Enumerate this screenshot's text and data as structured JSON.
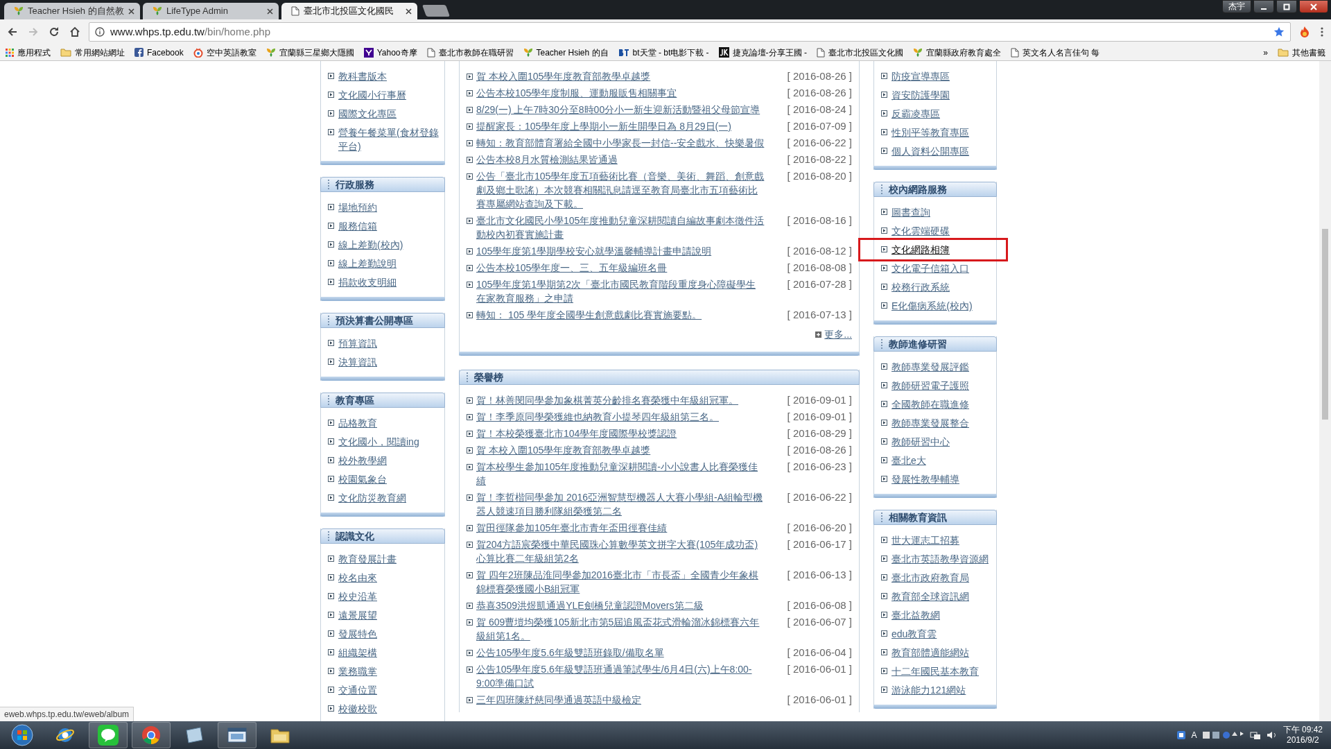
{
  "browser": {
    "tabs": [
      {
        "title": "Teacher Hsieh 的自然教",
        "kind": "leaf",
        "selected": false
      },
      {
        "title": "LifeType Admin",
        "kind": "leaf",
        "selected": false
      },
      {
        "title": "臺北市北投區文化國民",
        "kind": "page",
        "selected": true
      }
    ],
    "profile": "杰宇",
    "address": {
      "host": "www.whps.tp.edu.tw",
      "path": "/bin/home.php"
    },
    "bookmarks": [
      {
        "label": "應用程式",
        "kind": "apps"
      },
      {
        "label": "常用網站網址",
        "kind": "folder"
      },
      {
        "label": "Facebook",
        "kind": "facebook"
      },
      {
        "label": "空中英語教室",
        "kind": "radio"
      },
      {
        "label": "宜蘭縣三星鄉大隱國",
        "kind": "leaf"
      },
      {
        "label": "Yahoo奇摩",
        "kind": "yahoo"
      },
      {
        "label": "臺北市教師在職研習",
        "kind": "page"
      },
      {
        "label": "Teacher Hsieh 的自",
        "kind": "leaf"
      },
      {
        "label": "bt天堂 - bt电影下載 -",
        "kind": "bt"
      },
      {
        "label": "捷克論壇-分享王國 -",
        "kind": "jk"
      },
      {
        "label": "臺北市北投區文化國",
        "kind": "page"
      },
      {
        "label": "宜蘭縣政府教育處全",
        "kind": "leaf"
      },
      {
        "label": "英文名人名言佳句 每",
        "kind": "page"
      }
    ],
    "overflow": "»",
    "other_bookmarks": "其他書籤"
  },
  "left_panels": [
    {
      "items": [
        {
          "text": "教科書版本"
        },
        {
          "text": "文化國小行事曆"
        },
        {
          "text": "國際文化專區"
        },
        {
          "text": "營養午餐菜單(食材登錄平台)"
        }
      ]
    },
    {
      "title": "行政服務",
      "items": [
        {
          "text": "場地預約"
        },
        {
          "text": "服務信箱"
        },
        {
          "text": "線上差勤(校內)"
        },
        {
          "text": "線上差勤說明"
        },
        {
          "text": "捐款收支明細"
        }
      ]
    },
    {
      "title": "預決算書公開專區",
      "items": [
        {
          "text": "預算資訊"
        },
        {
          "text": "決算資訊"
        }
      ]
    },
    {
      "title": "教育專區",
      "items": [
        {
          "text": "品格教育"
        },
        {
          "text": "文化國小，閱讀ing"
        },
        {
          "text": "校外教學網"
        },
        {
          "text": "校園氣象台"
        },
        {
          "text": "文化防災教育網"
        }
      ]
    },
    {
      "title": "認識文化",
      "items": [
        {
          "text": "教育發展計畫"
        },
        {
          "text": "校名由來"
        },
        {
          "text": "校史沿革"
        },
        {
          "text": "遠景展望"
        },
        {
          "text": "發展特色"
        },
        {
          "text": "組織架構"
        },
        {
          "text": "業務職掌"
        },
        {
          "text": "交通位置"
        },
        {
          "text": "校徽校歌"
        }
      ]
    }
  ],
  "news": {
    "items": [
      {
        "text": "賀 本校入圍105學年度教育部教學卓越獎",
        "date": "[ 2016-08-26 ]"
      },
      {
        "text": "公告本校105學年度制服、運動服販售相關事宜",
        "date": "[ 2016-08-26 ]"
      },
      {
        "text": "8/29(一) 上午7時30分至8時00分小一新生迎新活動暨祖父母節宣導",
        "date": "[ 2016-08-24 ]"
      },
      {
        "text": "提醒家長：105學年度上學期小一新生開學日為 8月29日(一)",
        "date": "[ 2016-07-09 ]"
      },
      {
        "text": "轉知：教育部體育署給全國中小學家長一封信--安全戲水、快樂暑假",
        "date": "[ 2016-06-22 ]"
      },
      {
        "text": "公告本校8月水質檢測結果皆通過",
        "date": "[ 2016-08-22 ]"
      },
      {
        "text": "公告「臺北市105學年度五項藝術比賽（音樂、美術、舞蹈、創意戲劇及鄉土歌謠）本次競賽相關訊息請逕至教育局臺北市五項藝術比賽專屬網站查詢及下載。",
        "date": "[ 2016-08-20 ]"
      },
      {
        "text": "臺北市文化國民小學105年度推動兒童深耕閱讀自編故事劇本徵件活動校內初賽實施計畫",
        "date": "[ 2016-08-16 ]"
      },
      {
        "text": "105學年度第1學期學校安心就學溫馨輔導計畫申請說明",
        "date": "[ 2016-08-12 ]"
      },
      {
        "text": "公告本校105學年度一、三、五年級編班名冊",
        "date": "[ 2016-08-08 ]"
      },
      {
        "text": "105學年度第1學期第2次「臺北市國民教育階段重度身心障礙學生在家教育服務」之申請",
        "date": "[ 2016-07-28 ]"
      },
      {
        "text": "轉知： 105 學年度全國學生創意戲劇比賽實施要點。",
        "date": "[ 2016-07-13 ]"
      }
    ],
    "more": "更多..."
  },
  "honor": {
    "title": "榮譽榜",
    "items": [
      {
        "text": "賀！林善閔同學參加象棋菁英分齡排名賽榮獲中年級組冠軍。",
        "date": "[ 2016-09-01 ]"
      },
      {
        "text": "賀！李季原同學榮獲維也納教育小提琴四年級組第三名。",
        "date": "[ 2016-09-01 ]"
      },
      {
        "text": "賀！本校榮獲臺北市104學年度國際學校獎認證",
        "date": "[ 2016-08-29 ]"
      },
      {
        "text": "賀 本校入圍105學年度教育部教學卓越獎",
        "date": "[ 2016-08-26 ]"
      },
      {
        "text": "賀本校學生參加105年度推動兒童深耕閱讀-小小說書人比賽榮獲佳績",
        "date": "[ 2016-06-23 ]"
      },
      {
        "text": "賀！李哲楷同學參加 2016亞洲智慧型機器人大賽小學組-A組輪型機器人競速項目勝利隊組榮獲第二名",
        "date": "[ 2016-06-22 ]"
      },
      {
        "text": "賀田徑隊參加105年臺北市青年盃田徑賽佳績",
        "date": "[ 2016-06-20 ]"
      },
      {
        "text": "賀204方語宸榮獲中華民國珠心算數學英文拼字大賽(105年成功盃)心算比賽二年級組第2名",
        "date": "[ 2016-06-17 ]"
      },
      {
        "text": "賀 四年2班陳品淮同學參加2016臺北市「市長盃」全國青少年象棋錦標賽榮獲國小B組冠軍",
        "date": "[ 2016-06-13 ]"
      },
      {
        "text": "恭喜3509洪煜凱通過YLE劍橋兒童認證Movers第二級",
        "date": "[ 2016-06-08 ]"
      },
      {
        "text": "賀 609曹塏均榮獲105新北市第5屆追風盃花式滑輪溜冰錦標賽六年級組第1名。",
        "date": "[ 2016-06-07 ]"
      },
      {
        "text": "公告105學年度5.6年級雙語班錄取/備取名單",
        "date": "[ 2016-06-04 ]"
      },
      {
        "text": "公告105學年度5.6年級雙語班通過筆試學生/6月4日(六)上午8:00-9:00準備口試",
        "date": "[ 2016-06-01 ]"
      },
      {
        "text": "三年四班陳紓慈同學通過英語中級檢定",
        "date": "[ 2016-06-01 ]"
      }
    ]
  },
  "right_panels": [
    {
      "items": [
        {
          "text": "防疫宣導專區"
        },
        {
          "text": "資安防護學園"
        },
        {
          "text": "反霸凌專區"
        },
        {
          "text": "性別平等教育專區"
        },
        {
          "text": "個人資料公開專區"
        }
      ]
    },
    {
      "title": "校內網路服務",
      "items": [
        {
          "text": "圖書查詢",
          "highlighted": false
        },
        {
          "text": "文化雲端硬碟",
          "highlighted": false
        },
        {
          "text": "文化網路相簿",
          "highlighted": true
        },
        {
          "text": "文化電子信箱入口",
          "highlighted": false
        },
        {
          "text": "校務行政系統",
          "highlighted": false
        },
        {
          "text": "E化傷病系統(校內)",
          "highlighted": false
        }
      ]
    },
    {
      "title": "教師進修研習",
      "items": [
        {
          "text": "教師專業發展評鑑"
        },
        {
          "text": "教師研習電子護照"
        },
        {
          "text": "全國教師在職進修"
        },
        {
          "text": "教師專業發展整合"
        },
        {
          "text": "教師研習中心"
        },
        {
          "text": "臺北e大"
        },
        {
          "text": "發展性教學輔導"
        }
      ]
    },
    {
      "title": "相關教育資訊",
      "items": [
        {
          "text": "世大運志工招募"
        },
        {
          "text": "臺北市英語教學資源網"
        },
        {
          "text": "臺北市政府教育局"
        },
        {
          "text": "教育部全球資訊網"
        },
        {
          "text": "臺北益教網"
        },
        {
          "text": "edu教育雲"
        },
        {
          "text": "教育部體適能網站"
        },
        {
          "text": "十二年國民基本教育"
        },
        {
          "text": "游泳能力121網站"
        }
      ]
    }
  ],
  "status_bubble": "eweb.whps.tp.edu.tw/eweb/album",
  "taskbar": {
    "ime": "A",
    "time": "下午 09:42",
    "date": "2016/9/2"
  }
}
